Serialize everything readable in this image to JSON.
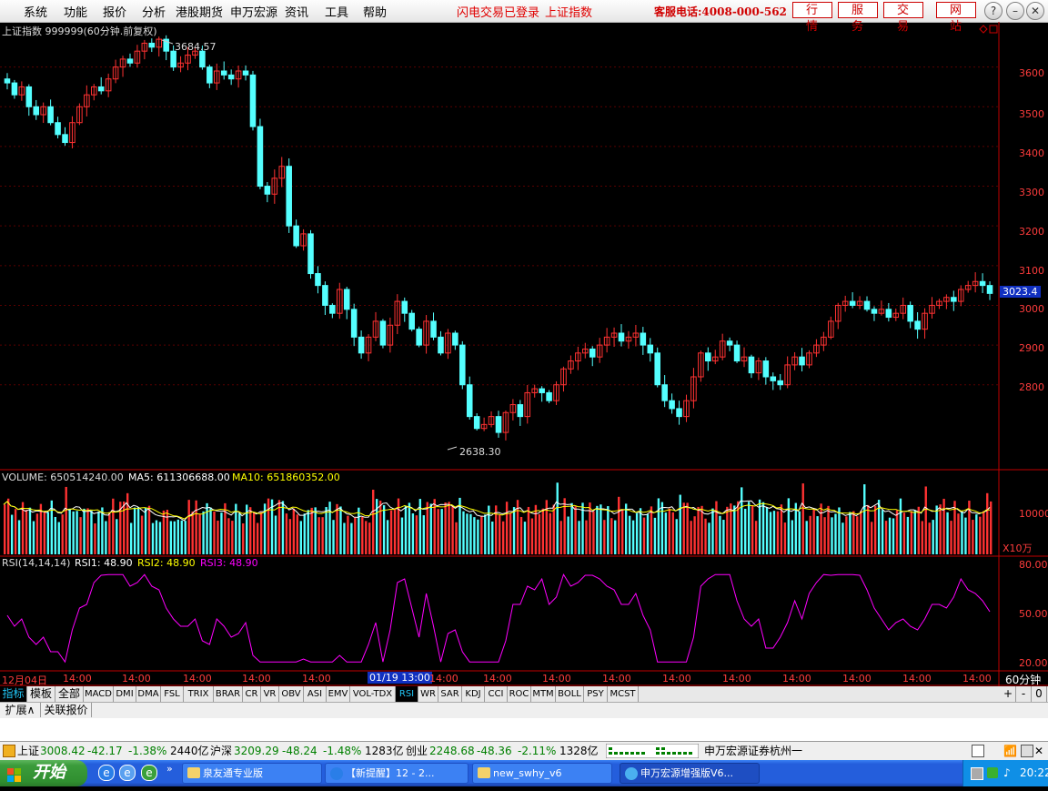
{
  "menubar": {
    "items": [
      "系统",
      "功能",
      "报价",
      "分析",
      "港股期货",
      "申万宏源",
      "资讯",
      "工具",
      "帮助"
    ],
    "status_login": "闪电交易已登录",
    "status_index": "上证指数",
    "hotline": "客服电话:4008-000-562",
    "buttons": [
      "行情",
      "服务",
      "交易",
      "网站"
    ]
  },
  "colors": {
    "up": "#ff3232",
    "down": "#54ffff",
    "axis": "#c00000",
    "ma5": "#ffffff",
    "ma10": "#ffff00",
    "rsi": "#ff00ff"
  },
  "price_panel": {
    "title": "上证指数 999999(60分钟.前复权)",
    "high_label": "3684.57",
    "low_label": "2638.30",
    "current_price": "3023.4",
    "y_ticks": [
      "3600",
      "3500",
      "3400",
      "3300",
      "3200",
      "3100",
      "3000",
      "2900",
      "2800"
    ]
  },
  "volume_panel": {
    "label": "VOLUME: 650514240.00",
    "ma5": "MA5: 611306688.00",
    "ma10": "MA10: 651860352.00",
    "tick": "10000",
    "unit": "X10万"
  },
  "rsi_panel": {
    "label": "RSI(14,14,14)",
    "rsi1": "RSI1: 48.90",
    "rsi2": "RSI2: 48.90",
    "rsi3": "RSI3: 48.90",
    "ticks": [
      "80.00",
      "50.00",
      "20.00"
    ]
  },
  "time_axis": {
    "labels": [
      "12月04日",
      "14:00",
      "14:00",
      "14:00",
      "14:00",
      "14:00",
      "01/19 13:00",
      "14:00",
      "14:00",
      "14:00",
      "14:00",
      "14:00",
      "14:00",
      "14:00",
      "14:00",
      "14:00",
      "14:00"
    ],
    "period": "60分钟"
  },
  "indicator_tabs": [
    "指标",
    "模板",
    "全部",
    "MACD",
    "DMI",
    "DMA",
    "FSL",
    "TRIX",
    "BRAR",
    "CR",
    "VR",
    "OBV",
    "ASI",
    "EMV",
    "VOL-TDX",
    "RSI",
    "WR",
    "SAR",
    "KDJ",
    "CCI",
    "ROC",
    "MTM",
    "BOLL",
    "PSY",
    "MCST"
  ],
  "nav_controls": [
    "+",
    "-",
    "0"
  ],
  "sub_tabs": [
    "扩展∧",
    "关联报价"
  ],
  "status_bar": {
    "sh_name": "上证",
    "sh_price": "3008.42",
    "sh_chg": "-42.17",
    "sh_pct": "-1.38%",
    "sh_amt": "2440亿",
    "hs_name": "沪深",
    "hs_price": "3209.29",
    "hs_chg": "-48.24",
    "hs_pct": "-1.48%",
    "hs_amt": "1283亿",
    "cy_name": "创业",
    "cy_price": "2248.68",
    "cy_chg": "-48.36",
    "cy_pct": "-2.11%",
    "cy_amt": "1328亿",
    "broker": "申万宏源证券杭州一"
  },
  "taskbar": {
    "start": "开始",
    "items": [
      "泉友通专业版",
      "【新提醒】12 - 2...",
      "new_swhy_v6",
      "申万宏源增强版V6..."
    ],
    "clock": "20:22"
  },
  "chart_data": {
    "type": "candlestick",
    "title": "上证指数 999999(60分钟.前复权)",
    "ylim": [
      2600,
      3700
    ],
    "high": 3684.57,
    "low": 2638.3,
    "last": 3023.4,
    "closes": [
      3560,
      3530,
      3550,
      3500,
      3480,
      3500,
      3460,
      3430,
      3410,
      3460,
      3500,
      3530,
      3550,
      3540,
      3570,
      3600,
      3620,
      3610,
      3640,
      3660,
      3650,
      3670,
      3640,
      3600,
      3610,
      3630,
      3640,
      3600,
      3560,
      3590,
      3580,
      3570,
      3590,
      3580,
      3450,
      3300,
      3280,
      3320,
      3350,
      3200,
      3150,
      3180,
      3080,
      3050,
      3000,
      2980,
      3040,
      2990,
      2920,
      2880,
      2920,
      2960,
      2900,
      2950,
      3010,
      2980,
      2940,
      2900,
      2960,
      2920,
      2880,
      2930,
      2900,
      2800,
      2720,
      2690,
      2700,
      2720,
      2680,
      2730,
      2750,
      2720,
      2780,
      2790,
      2780,
      2760,
      2800,
      2840,
      2860,
      2880,
      2890,
      2870,
      2900,
      2920,
      2930,
      2910,
      2920,
      2930,
      2900,
      2880,
      2800,
      2760,
      2740,
      2720,
      2760,
      2820,
      2880,
      2860,
      2870,
      2910,
      2900,
      2860,
      2870,
      2830,
      2860,
      2820,
      2810,
      2800,
      2850,
      2870,
      2850,
      2880,
      2900,
      2920,
      2960,
      3000,
      3010,
      3000,
      3010,
      2990,
      2980,
      2990,
      2970,
      2980,
      3000,
      2960,
      2940,
      2980,
      3000,
      3010,
      3020,
      3010,
      3040,
      3050,
      3060,
      3050,
      3030
    ],
    "volume_max": 15000,
    "rsi_ticks": [
      80,
      50,
      20
    ]
  }
}
